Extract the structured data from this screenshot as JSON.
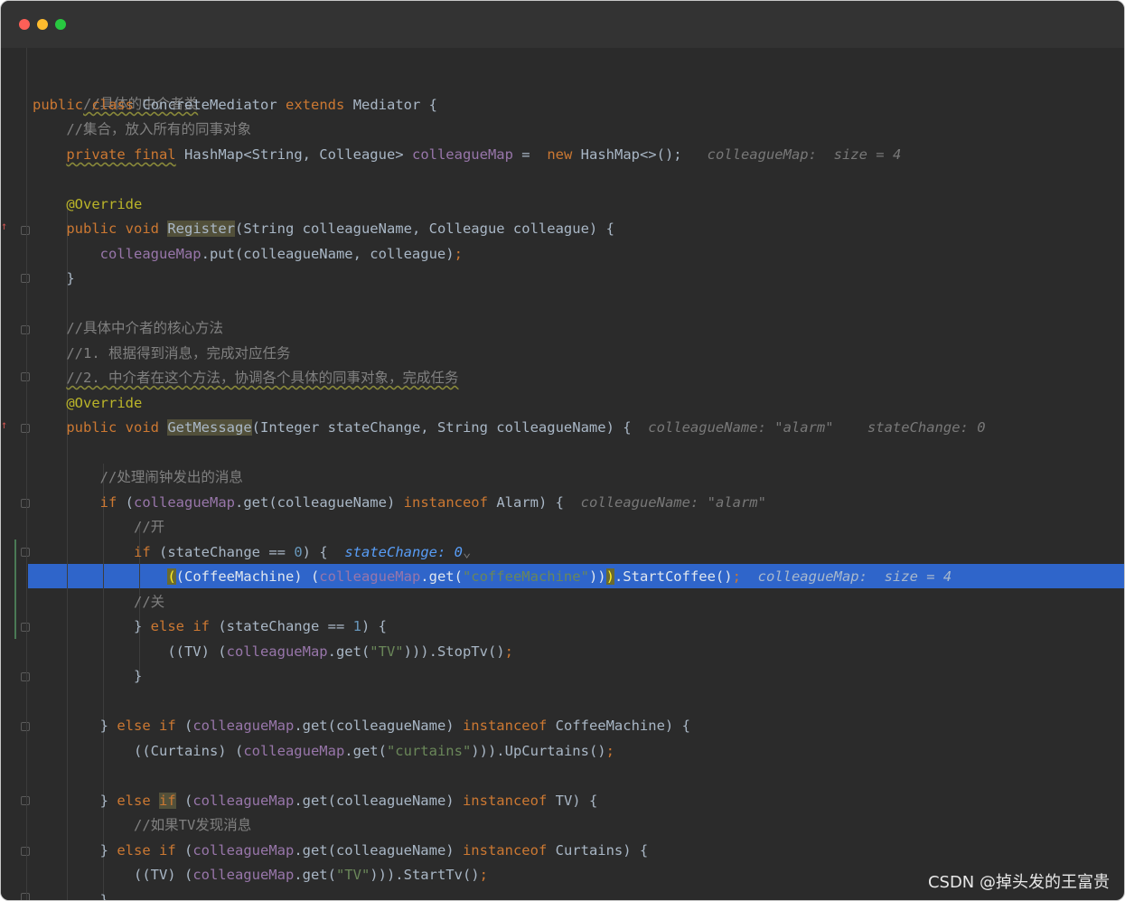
{
  "window": {
    "controls": [
      "close",
      "minimize",
      "maximize"
    ]
  },
  "code": {
    "l1_comment": "//具体的中介者类",
    "l2_public": "public",
    "l2_class": "class",
    "l2_name": "ConcreteMediator",
    "l2_extends": "extends",
    "l2_parent": "Mediator {",
    "l3_comment": "//集合，放入所有的同事对象",
    "l4_private_final": "private final",
    "l4_type": "HashMap<String, Colleague>",
    "l4_field": "colleagueMap",
    "l4_eq": " = ",
    "l4_new": "new",
    "l4_ctor": "HashMap<>();",
    "l4_hint": "colleagueMap:  size = 4",
    "l6_ann": "@Override",
    "l7_mod": "public void",
    "l7_method": "Register",
    "l7_params": "(String colleagueName, Colleague colleague) {",
    "l8_field": "colleagueMap",
    "l8_rest": ".put(colleagueName, colleague)",
    "l8_semi": ";",
    "l9_close": "}",
    "l11_comment": "//具体中介者的核心方法",
    "l12_comment": "//1. 根据得到消息，完成对应任务",
    "l13_comment": "//2. 中介者在这个方法，协调各个具体的同事对象，完成任务",
    "l14_ann": "@Override",
    "l15_mod": "public void",
    "l15_method": "GetMessage",
    "l15_params": "(Integer stateChange, String colleagueName) {",
    "l15_hint1": "colleagueName: \"alarm\"",
    "l15_hint2": "stateChange: 0",
    "l17_comment": "//处理闹钟发出的消息",
    "l18_if": "if",
    "l18_paren": "(",
    "l18_field": "colleagueMap",
    "l18_rest": ".get(colleagueName)",
    "l18_instanceof": "instanceof",
    "l18_type": "Alarm) {",
    "l18_hint": "colleagueName: \"alarm\"",
    "l19_comment": "//开",
    "l20_if": "if",
    "l20_cond": "(stateChange == ",
    "l20_num": "0",
    "l20_close": ") {",
    "l20_hint": "stateChange: 0",
    "l20_chev": "⌄",
    "l21_open": "(",
    "l21_cast": "(CoffeeMachine) (",
    "l21_field": "colleagueMap",
    "l21_get": ".get(",
    "l21_str": "\"coffeeMachine\"",
    "l21_close1": "))",
    "l21_close2": ")",
    "l21_call": ".StartCoffee()",
    "l21_semi": ";",
    "l21_hint": "colleagueMap:  size = 4",
    "l22_comment": "//关",
    "l23_brace": "} ",
    "l23_else_if": "else if",
    "l23_cond": " (stateChange == ",
    "l23_num": "1",
    "l23_close": ") {",
    "l24_cast": "((TV) (",
    "l24_field": "colleagueMap",
    "l24_get": ".get(",
    "l24_str": "\"TV\"",
    "l24_rest": "))).StopTv()",
    "l24_semi": ";",
    "l25_close": "}",
    "l27_brace": "} ",
    "l27_else_if": "else if",
    "l27_paren": " (",
    "l27_field": "colleagueMap",
    "l27_rest": ".get(colleagueName) ",
    "l27_instanceof": "instanceof",
    "l27_type": " CoffeeMachine) {",
    "l28_cast": "((Curtains) (",
    "l28_field": "colleagueMap",
    "l28_get": ".get(",
    "l28_str": "\"curtains\"",
    "l28_rest": "))).UpCurtains()",
    "l28_semi": ";",
    "l30_brace": "} ",
    "l30_else": "else",
    "l30_if": "if",
    "l30_paren": " (",
    "l30_field": "colleagueMap",
    "l30_rest": ".get(colleagueName) ",
    "l30_instanceof": "instanceof",
    "l30_type": " TV) {",
    "l31_comment": "//如果TV发现消息",
    "l32_brace": "} ",
    "l32_else_if": "else if",
    "l32_paren": " (",
    "l32_field": "colleagueMap",
    "l32_rest": ".get(colleagueName) ",
    "l32_instanceof": "instanceof",
    "l32_type": " Curtains) {",
    "l33_cast": "((TV) (",
    "l33_field": "colleagueMap",
    "l33_get": ".get(",
    "l33_str": "\"TV\"",
    "l33_rest": "))).StartTv()",
    "l33_semi": ";",
    "l34_close": "}"
  },
  "watermark": "CSDN @掉头发的王富贵",
  "colors": {
    "background": "#2b2b2b",
    "keyword": "#cc7832",
    "field": "#9876aa",
    "string": "#6a8759",
    "number": "#6897bb",
    "comment": "#808080",
    "annotation": "#bbb529",
    "execution_line": "#2f65ca"
  }
}
